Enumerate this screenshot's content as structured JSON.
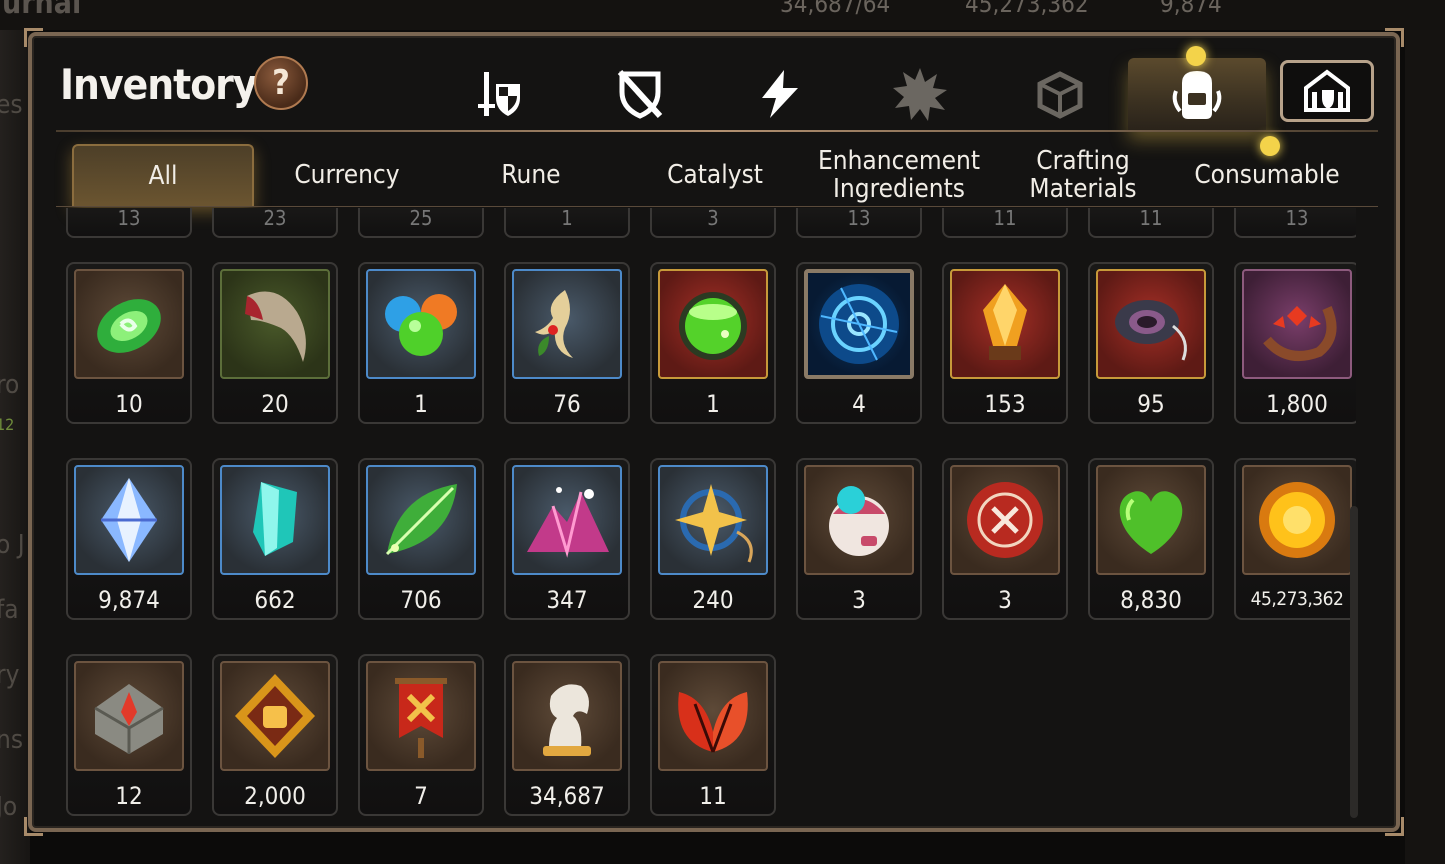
{
  "background": {
    "top_left_fragment": "urnal",
    "resource_values": [
      "34,687/64",
      "45,273,362",
      "9,874"
    ],
    "left_fragments": [
      "es",
      "ro",
      "12",
      "o J",
      "fa",
      "ry",
      "ns",
      "Jo"
    ]
  },
  "header": {
    "title": "Inventory",
    "help_label": "?"
  },
  "icon_tabs": [
    {
      "name": "equipment",
      "icon": "sword-shield-icon",
      "color": "#ffffff"
    },
    {
      "name": "unequipped",
      "icon": "crossed-shield-icon",
      "color": "#ffffff"
    },
    {
      "name": "energy",
      "icon": "lightning-icon",
      "color": "#ffffff"
    },
    {
      "name": "artifact",
      "icon": "splat-icon",
      "color": "#6b6761"
    },
    {
      "name": "box",
      "icon": "box-icon",
      "color": "#6b6761"
    },
    {
      "name": "bag",
      "icon": "backpack-icon",
      "color": "#ffffff",
      "active": true
    },
    {
      "name": "storage",
      "icon": "house-icon",
      "color": "#ffffff"
    }
  ],
  "category_tabs": [
    "All",
    "Currency",
    "Rune",
    "Catalyst",
    "Enhancement Ingredients",
    "Crafting Materials",
    "Consumable"
  ],
  "partial_row_counts": [
    "13",
    "23",
    "25",
    "1",
    "3",
    "13",
    "11",
    "11",
    "13"
  ],
  "items": [
    {
      "count": "10",
      "frame": "brown",
      "icon": "green-eye-gem-icon"
    },
    {
      "count": "20",
      "frame": "green",
      "icon": "claw-icon"
    },
    {
      "count": "1",
      "frame": "blue",
      "icon": "orbs-icon"
    },
    {
      "count": "76",
      "frame": "blue",
      "icon": "root-icon"
    },
    {
      "count": "1",
      "frame": "red",
      "icon": "green-potion-icon"
    },
    {
      "count": "4",
      "frame": "round",
      "icon": "blue-rune-icon"
    },
    {
      "count": "153",
      "frame": "red",
      "icon": "amber-crystal-icon"
    },
    {
      "count": "95",
      "frame": "red",
      "icon": "ring-icon"
    },
    {
      "count": "1,800",
      "frame": "purple",
      "icon": "red-charm-icon"
    },
    {
      "count": "9,874",
      "frame": "blue",
      "icon": "crystal-gem-icon"
    },
    {
      "count": "662",
      "frame": "blue",
      "icon": "teal-crystal-icon"
    },
    {
      "count": "706",
      "frame": "blue",
      "icon": "leaf-icon"
    },
    {
      "count": "347",
      "frame": "blue",
      "icon": "pink-crystals-icon"
    },
    {
      "count": "240",
      "frame": "blue",
      "icon": "star-compass-icon"
    },
    {
      "count": "3",
      "frame": "brown",
      "icon": "orb-toy-icon"
    },
    {
      "count": "3",
      "frame": "brown",
      "icon": "red-seal-icon"
    },
    {
      "count": "8,830",
      "frame": "brown",
      "icon": "green-heart-icon"
    },
    {
      "count": "45,273,362",
      "frame": "brown",
      "icon": "gold-coin-icon",
      "small": true
    },
    {
      "count": "12",
      "frame": "brown",
      "icon": "stone-compass-icon"
    },
    {
      "count": "2,000",
      "frame": "brown",
      "icon": "fist-emblem-icon"
    },
    {
      "count": "7",
      "frame": "brown",
      "icon": "banner-icon"
    },
    {
      "count": "34,687",
      "frame": "brown",
      "icon": "horse-icon"
    },
    {
      "count": "11",
      "frame": "brown",
      "icon": "red-leaves-icon"
    }
  ]
}
